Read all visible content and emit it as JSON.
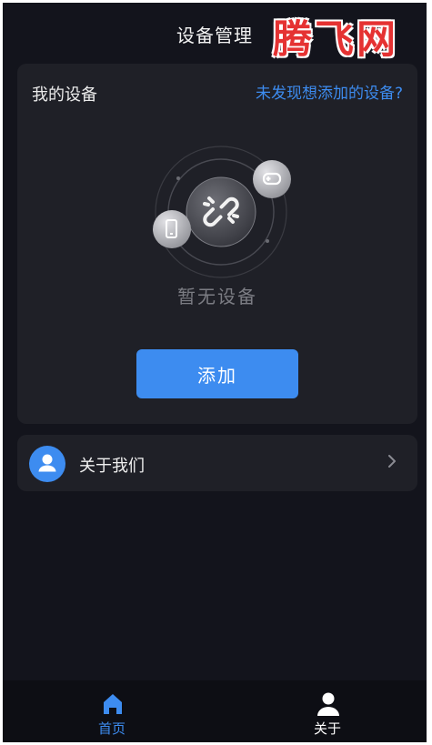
{
  "header": {
    "title": "设备管理"
  },
  "watermark": {
    "text": "腾飞网"
  },
  "devices": {
    "title": "我的设备",
    "help_link": "未发现想添加的设备?",
    "empty_text": "暂无设备",
    "add_button": "添加"
  },
  "about": {
    "label": "关于我们"
  },
  "tabbar": {
    "items": [
      {
        "label": "首页",
        "icon": "home-icon",
        "active": true
      },
      {
        "label": "关于",
        "icon": "person-icon",
        "active": false
      }
    ]
  },
  "colors": {
    "accent": "#3d8cf0",
    "background": "#13141c",
    "card": "#1f2027",
    "watermark": "#e53232"
  }
}
